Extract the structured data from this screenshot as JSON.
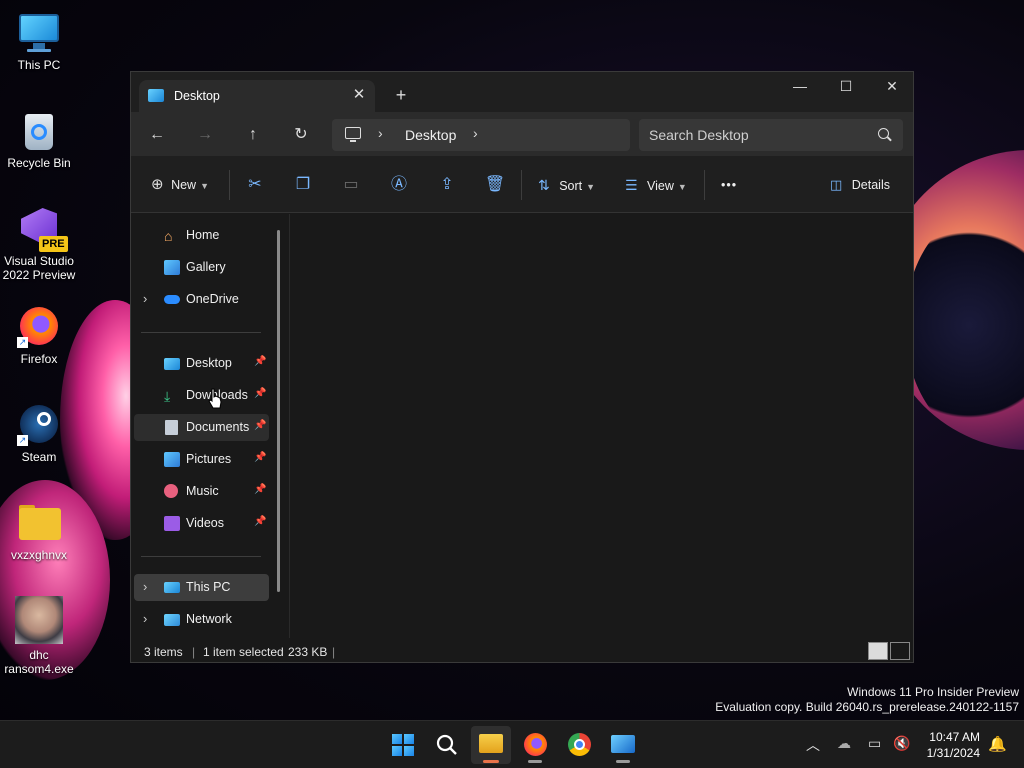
{
  "desktop": {
    "icons": [
      {
        "label": "This PC",
        "icon": "this-pc-icon"
      },
      {
        "label": "Recycle Bin",
        "icon": "recycle-bin-icon"
      },
      {
        "label": "Visual Studio 2022 Preview",
        "icon": "visual-studio-icon",
        "badge": "PRE"
      },
      {
        "label": "Firefox",
        "icon": "firefox-icon"
      },
      {
        "label": "Steam",
        "icon": "steam-icon"
      },
      {
        "label": "vxzxghnvx",
        "icon": "folder-icon"
      },
      {
        "label": "dhc ransom4.exe",
        "icon": "exe-icon"
      }
    ],
    "watermark": {
      "line1": "Windows 11 Pro Insider Preview",
      "line2": "Evaluation copy. Build 26040.rs_prerelease.240122-1157"
    }
  },
  "explorer": {
    "tab_title": "Desktop",
    "tab_close": "✕",
    "new_tab": "+",
    "caption": {
      "minimize": "—",
      "maximize": "☐",
      "close": "✕"
    },
    "nav": {
      "back": "←",
      "forward": "→",
      "up": "↑",
      "refresh": "↻"
    },
    "address": {
      "chevron": "›",
      "location": "Desktop"
    },
    "search": {
      "placeholder": "Search Desktop"
    },
    "toolbar": {
      "new_label": "New",
      "sort_label": "Sort",
      "view_label": "View",
      "more_label": "•••",
      "details_label": "Details"
    },
    "sidebar": {
      "items": [
        {
          "label": "Home",
          "icon": "home-icon"
        },
        {
          "label": "Gallery",
          "icon": "gallery-icon"
        },
        {
          "label": "OneDrive",
          "icon": "onedrive-icon",
          "expandable": true
        },
        {
          "label": "Desktop",
          "icon": "desktop-folder-icon",
          "pinned": true
        },
        {
          "label": "Downloads",
          "icon": "downloads-icon",
          "pinned": true
        },
        {
          "label": "Documents",
          "icon": "documents-icon",
          "pinned": true,
          "hover": true
        },
        {
          "label": "Pictures",
          "icon": "pictures-icon",
          "pinned": true
        },
        {
          "label": "Music",
          "icon": "music-icon",
          "pinned": true
        },
        {
          "label": "Videos",
          "icon": "videos-icon",
          "pinned": true
        },
        {
          "label": "This PC",
          "icon": "this-pc-icon",
          "expandable": true,
          "selected": true
        },
        {
          "label": "Network",
          "icon": "network-icon",
          "expandable": true
        }
      ]
    },
    "status": {
      "items": "3 items",
      "selected": "1 item selected",
      "size": "233 KB",
      "sep": "|"
    }
  },
  "taskbar": {
    "apps": [
      {
        "name": "start",
        "icon": "windows-logo-icon"
      },
      {
        "name": "search",
        "icon": "search-icon"
      },
      {
        "name": "file-explorer",
        "icon": "file-explorer-icon",
        "active": true
      },
      {
        "name": "firefox",
        "icon": "firefox-icon"
      },
      {
        "name": "chrome",
        "icon": "chrome-icon"
      },
      {
        "name": "photos",
        "icon": "photos-icon"
      }
    ],
    "time": "10:47 AM",
    "date": "1/31/2024"
  },
  "colors": {
    "accent": "#7ab8ff",
    "active_indicator": "#e8734a",
    "window_bg": "#191919"
  }
}
